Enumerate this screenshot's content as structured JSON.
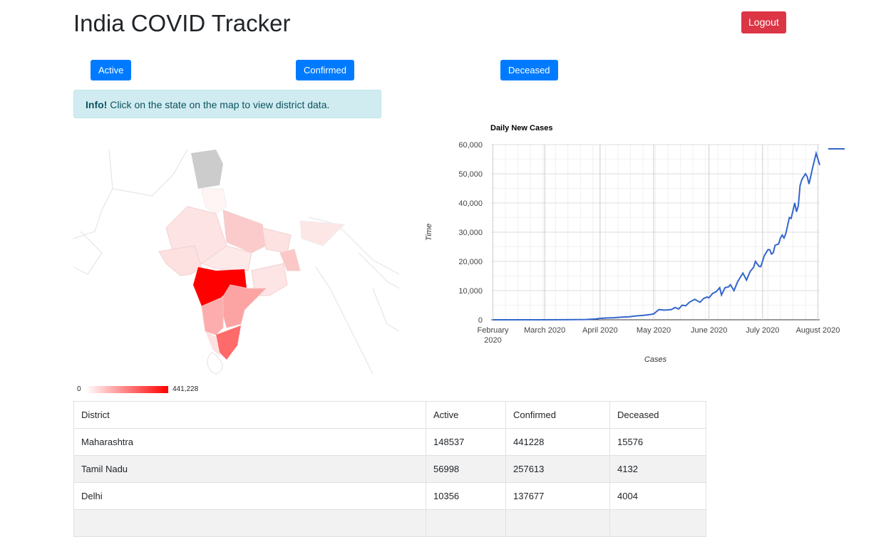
{
  "header": {
    "title": "India COVID Tracker",
    "logout": "Logout"
  },
  "metric_buttons": [
    "Active",
    "Confirmed",
    "Deceased"
  ],
  "info": {
    "bold": "Info!",
    "text": " Click on the state on the map to view district data."
  },
  "map_legend": {
    "min": "0",
    "max": "441,228"
  },
  "colors": {
    "primary": "#007bff",
    "danger": "#dc3545",
    "line": "#3366cc"
  },
  "table": {
    "headers": [
      "District",
      "Active",
      "Confirmed",
      "Deceased"
    ],
    "rows": [
      [
        "Maharashtra",
        "148537",
        "441228",
        "15576"
      ],
      [
        "Tamil Nadu",
        "56998",
        "257613",
        "4132"
      ],
      [
        "Delhi",
        "10356",
        "137677",
        "4004"
      ],
      [
        "",
        "",
        "",
        ""
      ]
    ]
  },
  "chart_data": {
    "type": "line",
    "title": "Daily New Cases",
    "xlabel": "Cases",
    "ylabel": "Time",
    "ylim": [
      0,
      60000
    ],
    "yticks": [
      "0",
      "10,000",
      "20,000",
      "30,000",
      "40,000",
      "50,000",
      "60,000"
    ],
    "xticks": [
      {
        "day": 0,
        "label": "February",
        "label2": "2020"
      },
      {
        "day": 29,
        "label": "March 2020"
      },
      {
        "day": 60,
        "label": "April 2020"
      },
      {
        "day": 90,
        "label": "May 2020"
      },
      {
        "day": 121,
        "label": "June 2020"
      },
      {
        "day": 151,
        "label": "July 2020"
      },
      {
        "day": 182,
        "label": "August 2020"
      }
    ],
    "x_unit": "days since 2020-02-01",
    "xlim": [
      -1,
      183
    ],
    "points": [
      [
        0,
        0
      ],
      [
        40,
        20
      ],
      [
        52,
        100
      ],
      [
        58,
        300
      ],
      [
        60,
        500
      ],
      [
        64,
        650
      ],
      [
        68,
        700
      ],
      [
        72,
        900
      ],
      [
        76,
        1000
      ],
      [
        80,
        1300
      ],
      [
        84,
        1500
      ],
      [
        88,
        1800
      ],
      [
        90,
        2000
      ],
      [
        93,
        3500
      ],
      [
        96,
        3300
      ],
      [
        100,
        3500
      ],
      [
        102,
        4200
      ],
      [
        104,
        3700
      ],
      [
        106,
        5000
      ],
      [
        108,
        4800
      ],
      [
        110,
        6000
      ],
      [
        113,
        7000
      ],
      [
        116,
        6000
      ],
      [
        118,
        7300
      ],
      [
        120,
        7800
      ],
      [
        121,
        7500
      ],
      [
        123,
        9000
      ],
      [
        125,
        9600
      ],
      [
        127,
        11000
      ],
      [
        128,
        8500
      ],
      [
        130,
        11000
      ],
      [
        132,
        11300
      ],
      [
        133,
        12000
      ],
      [
        135,
        10000
      ],
      [
        137,
        13000
      ],
      [
        140,
        16000
      ],
      [
        142,
        13600
      ],
      [
        144,
        16500
      ],
      [
        146,
        18000
      ],
      [
        147,
        20000
      ],
      [
        149,
        18300
      ],
      [
        150,
        18200
      ],
      [
        152,
        22000
      ],
      [
        154,
        24000
      ],
      [
        155,
        24000
      ],
      [
        156,
        22500
      ],
      [
        157,
        23000
      ],
      [
        158,
        25500
      ],
      [
        160,
        26000
      ],
      [
        161,
        28000
      ],
      [
        162,
        29000
      ],
      [
        163,
        28000
      ],
      [
        164,
        29500
      ],
      [
        166,
        35000
      ],
      [
        167,
        34700
      ],
      [
        169,
        40000
      ],
      [
        170,
        37000
      ],
      [
        171,
        39000
      ],
      [
        172,
        46000
      ],
      [
        173,
        48000
      ],
      [
        175,
        50000
      ],
      [
        176,
        49000
      ],
      [
        177,
        46500
      ],
      [
        179,
        52000
      ],
      [
        181,
        57000
      ],
      [
        183,
        53000
      ]
    ]
  }
}
